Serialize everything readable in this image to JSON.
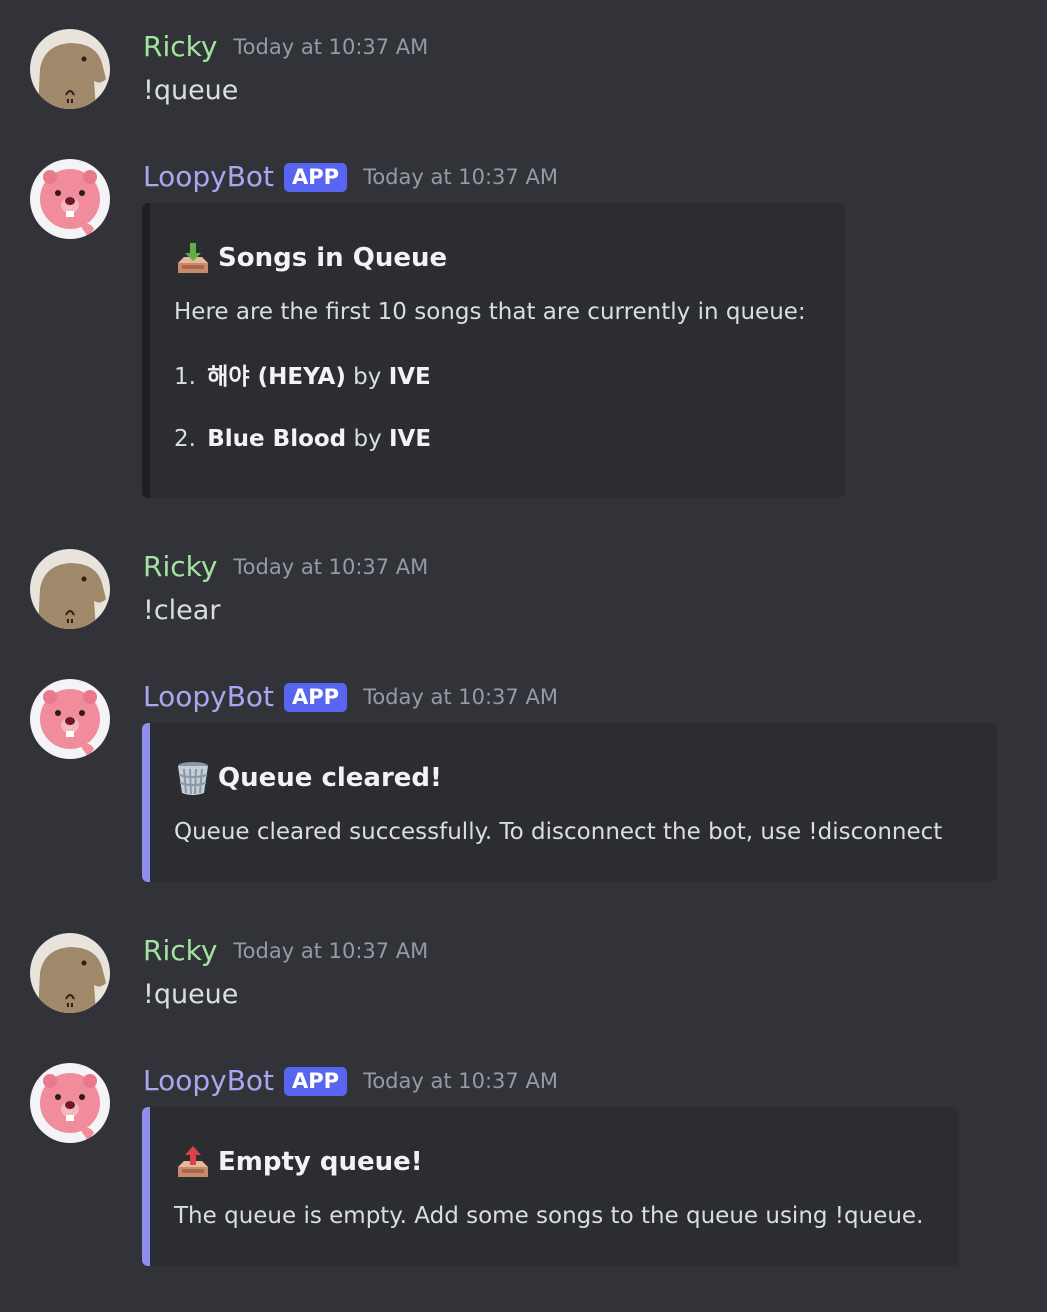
{
  "users": {
    "ricky": {
      "name": "Ricky",
      "color": "#a3e4a0",
      "avatar_icon": "capybara-icon"
    },
    "bot": {
      "name": "LoopyBot",
      "badge": "APP",
      "color": "#a8a8f2",
      "avatar_icon": "loopy-beaver-icon"
    }
  },
  "messages": [
    {
      "author": "Ricky",
      "timestamp": "Today at 10:37 AM",
      "content": "!queue"
    },
    {
      "author": "LoopyBot",
      "badge": "APP",
      "timestamp": "Today at 10:37 AM",
      "embed": {
        "accent_color": "#1e1f22",
        "emoji": "inbox-tray-icon",
        "title": "Songs in Queue",
        "description": "Here are the first 10 songs that are currently in queue:",
        "songs": [
          {
            "number": "1.",
            "title": "해야 (HEYA)",
            "by": "by",
            "artist": "IVE"
          },
          {
            "number": "2.",
            "title": "Blue Blood",
            "by": "by",
            "artist": "IVE"
          }
        ]
      }
    },
    {
      "author": "Ricky",
      "timestamp": "Today at 10:37 AM",
      "content": "!clear"
    },
    {
      "author": "LoopyBot",
      "badge": "APP",
      "timestamp": "Today at 10:37 AM",
      "embed": {
        "accent_color": "#8f8ff0",
        "emoji": "wastebasket-icon",
        "title": "Queue cleared!",
        "description": "Queue cleared successfully. To disconnect the bot, use !disconnect"
      }
    },
    {
      "author": "Ricky",
      "timestamp": "Today at 10:37 AM",
      "content": "!queue"
    },
    {
      "author": "LoopyBot",
      "badge": "APP",
      "timestamp": "Today at 10:37 AM",
      "embed": {
        "accent_color": "#8f8ff0",
        "emoji": "outbox-tray-icon",
        "title": "Empty queue!",
        "description": "The queue is empty. Add some songs to the queue using !queue."
      }
    }
  ]
}
